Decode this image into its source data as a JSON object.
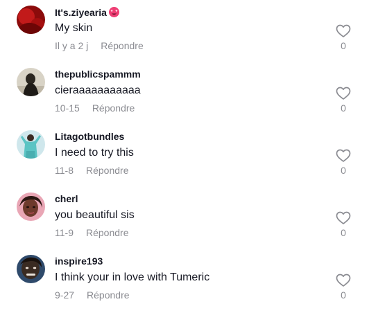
{
  "comments": [
    {
      "username": "It's.ziyearia",
      "username_emoji": "smiling-face-with-heart-eyes",
      "text": "My skin",
      "time": "Il y a 2 j",
      "reply_label": "Répondre",
      "likes": "0",
      "avatar_colors": [
        "#8b0b0b",
        "#c21a1a"
      ]
    },
    {
      "username": "thepublicspammm",
      "text": "cieraaaaaaaaaaa",
      "time": "10-15",
      "reply_label": "Répondre",
      "likes": "0",
      "avatar_colors": [
        "#d8d3c6",
        "#2a2620"
      ]
    },
    {
      "username": "Litagotbundles",
      "text": "I need to try this",
      "time": "11-8",
      "reply_label": "Répondre",
      "likes": "0",
      "avatar_colors": [
        "#cfe7ec",
        "#5bc4c4"
      ]
    },
    {
      "username": "cherl",
      "text": "you beautiful sis",
      "time": "11-9",
      "reply_label": "Répondre",
      "likes": "0",
      "avatar_colors": [
        "#e9a6b5",
        "#6e3a2c"
      ]
    },
    {
      "username": "inspire193",
      "text": "I think your in love with Tumeric",
      "time": "9-27",
      "reply_label": "Répondre",
      "likes": "0",
      "avatar_colors": [
        "#3a2b22",
        "#2f4a6b"
      ]
    }
  ]
}
